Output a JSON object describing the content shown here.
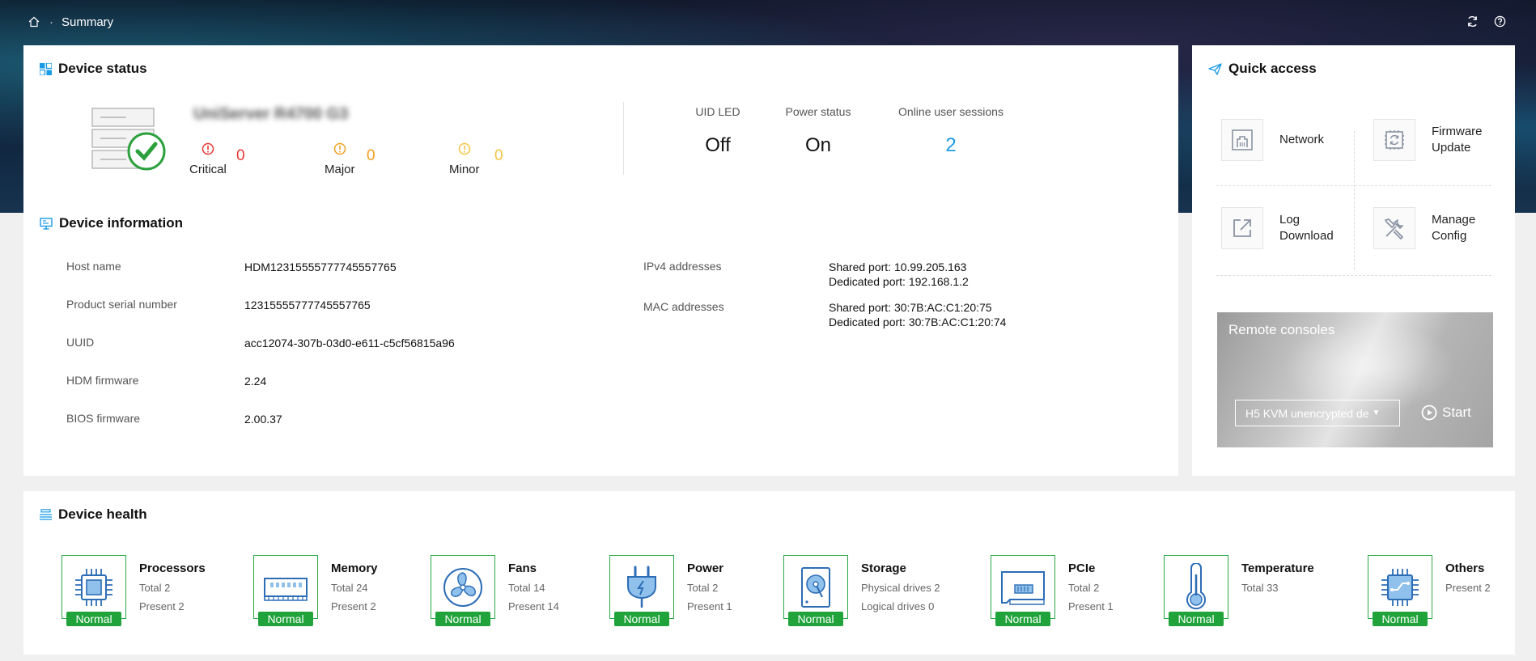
{
  "breadcrumb": {
    "page": "Summary"
  },
  "device_status": {
    "title": "Device status",
    "model": "UniServer R4700 G3",
    "alarms": [
      {
        "label": "Critical",
        "count": "0",
        "color": "#e53935"
      },
      {
        "label": "Major",
        "count": "0",
        "color": "#f0a020"
      },
      {
        "label": "Minor",
        "count": "0",
        "color": "#f5c442"
      }
    ],
    "uid_led": {
      "label": "UID LED",
      "value": "Off"
    },
    "power_status": {
      "label": "Power status",
      "value": "On"
    },
    "sessions": {
      "label": "Online user sessions",
      "value": "2"
    }
  },
  "device_info": {
    "title": "Device information",
    "host_name": {
      "label": "Host name",
      "value": "HDM12315555777745557765"
    },
    "serial": {
      "label": "Product serial number",
      "value": "12315555777745557765"
    },
    "uuid": {
      "label": "UUID",
      "value": "acc12074-307b-03d0-e611-c5cf56815a96"
    },
    "hdm_fw": {
      "label": "HDM firmware",
      "value": "2.24"
    },
    "bios_fw": {
      "label": "BIOS firmware",
      "value": "2.00.37"
    },
    "ipv4": {
      "label": "IPv4 addresses",
      "line1": "Shared port: 10.99.205.163",
      "line2": "Dedicated port: 192.168.1.2"
    },
    "mac": {
      "label": "MAC addresses",
      "line1": "Shared port: 30:7B:AC:C1:20:75",
      "line2": "Dedicated port: 30:7B:AC:C1:20:74"
    }
  },
  "quick_access": {
    "title": "Quick access",
    "network": "Network",
    "firmware_1": "Firmware",
    "firmware_2": "Update",
    "log_1": "Log",
    "log_2": "Download",
    "manage_1": "Manage",
    "manage_2": "Config",
    "remote": {
      "title": "Remote consoles",
      "selected": "H5 KVM unencrypted de",
      "start": "Start"
    }
  },
  "device_health": {
    "title": "Device health",
    "status_label": "Normal",
    "components": [
      {
        "name": "Processors",
        "l1": "Total 2",
        "l2": "Present 2"
      },
      {
        "name": "Memory",
        "l1": "Total 24",
        "l2": "Present 2"
      },
      {
        "name": "Fans",
        "l1": "Total 14",
        "l2": "Present 14"
      },
      {
        "name": "Power",
        "l1": "Total 2",
        "l2": "Present 1"
      },
      {
        "name": "Storage",
        "l1": "Physical drives 2",
        "l2": "Logical drives 0"
      },
      {
        "name": "PCIe",
        "l1": "Total 2",
        "l2": "Present 1"
      },
      {
        "name": "Temperature",
        "l1": "Total 33",
        "l2": ""
      },
      {
        "name": "Others",
        "l1": "Present 2",
        "l2": ""
      }
    ]
  },
  "colors": {
    "accent": "#1a9be6",
    "normal": "#1fa33a",
    "icon_blue": "#2d6db5"
  }
}
